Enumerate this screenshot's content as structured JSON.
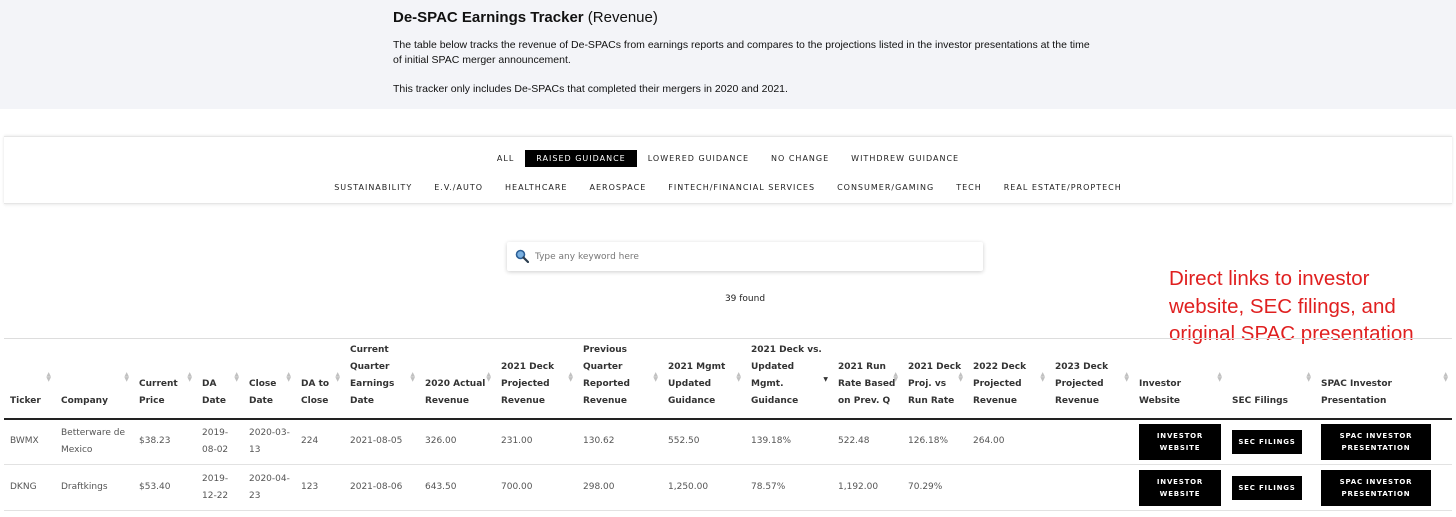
{
  "intro": {
    "title_bold": "De-SPAC Earnings Tracker",
    "title_rest": " (Revenue)",
    "paragraph1": "The table below tracks the revenue of De-SPACs from earnings reports and compares to the projections listed in the investor presentations at the time of initial SPAC merger announcement.",
    "paragraph2": "This tracker only includes De-SPACs that completed their mergers in 2020 and 2021."
  },
  "filters": {
    "row1": [
      "ALL",
      "RAISED GUIDANCE",
      "LOWERED GUIDANCE",
      "NO CHANGE",
      "WITHDREW GUIDANCE"
    ],
    "row2": [
      "SUSTAINABILITY",
      "E.V./AUTO",
      "HEALTHCARE",
      "AEROSPACE",
      "FINTECH/FINANCIAL SERVICES",
      "CONSUMER/GAMING",
      "TECH",
      "REAL ESTATE/PROPTECH"
    ],
    "active": "RAISED GUIDANCE"
  },
  "search": {
    "placeholder": "Type any keyword here",
    "value": ""
  },
  "results": {
    "found_text": "39 found"
  },
  "annotation": {
    "text": "Direct links to investor website, SEC filings, and original SPAC presentation"
  },
  "table": {
    "headers": [
      "Ticker",
      "Company",
      "Current Price",
      "DA Date",
      "Close Date",
      "DA to Close",
      "Current Quarter Earnings Date",
      "2020 Actual Revenue",
      "2021 Deck Projected Revenue",
      "Previous Quarter Reported Revenue",
      "2021 Mgmt Updated Guidance",
      "2021 Deck vs. Updated Mgmt. Guidance",
      "2021 Run Rate Based on Prev. Q",
      "2021 Deck Proj. vs Run Rate",
      "2022 Deck Projected Revenue",
      "2023 Deck Projected Revenue",
      "Investor Website",
      "SEC Filings",
      "SPAC Investor Presentation"
    ],
    "sorted_column": 11,
    "rows": [
      {
        "cells": [
          "BWMX",
          "Betterware de Mexico",
          "$38.23",
          "2019-08-02",
          "2020-03-13",
          "224",
          "2021-08-05",
          "326.00",
          "231.00",
          "130.62",
          "552.50",
          "139.18%",
          "522.48",
          "126.18%",
          "264.00",
          ""
        ],
        "investor_label": "INVESTOR WEBSITE",
        "sec_label": "SEC FILINGS",
        "spac_label": "SPAC INVESTOR PRESENTATION"
      },
      {
        "cells": [
          "DKNG",
          "Draftkings",
          "$53.40",
          "2019-12-22",
          "2020-04-23",
          "123",
          "2021-08-06",
          "643.50",
          "700.00",
          "298.00",
          "1,250.00",
          "78.57%",
          "1,192.00",
          "70.29%",
          "",
          ""
        ],
        "investor_label": "INVESTOR WEBSITE",
        "sec_label": "SEC FILINGS",
        "spac_label": "SPAC INVESTOR PRESENTATION"
      }
    ]
  }
}
